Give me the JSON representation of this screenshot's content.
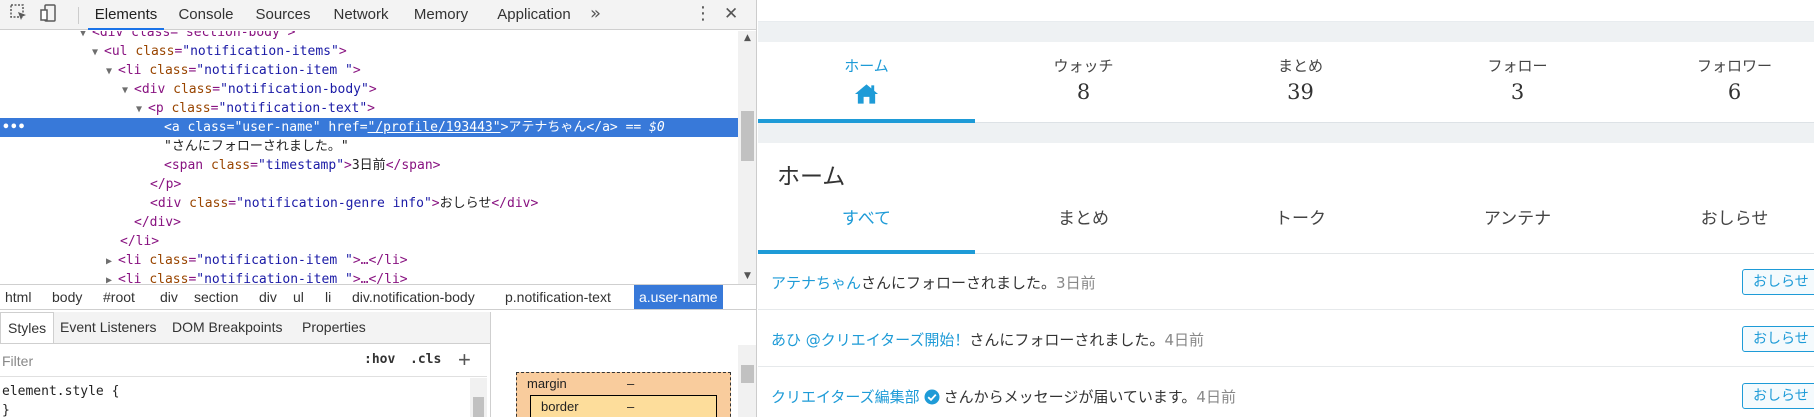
{
  "devtools": {
    "tabs": [
      "Elements",
      "Console",
      "Sources",
      "Network",
      "Memory",
      "Application"
    ],
    "active_tab": "Elements",
    "more_tabs_glyph": "»",
    "menu_glyph": "⋮",
    "close_glyph": "✕",
    "dom_lines": {
      "l0": {
        "tag_open": "<div class=\"section-body\">"
      },
      "l1": {
        "tag": "<ul",
        "attr": "class",
        "val": "\"notification-items\"",
        "end": ">"
      },
      "l2": {
        "tag": "<li",
        "attr": "class",
        "val": "\"notification-item \"",
        "end": ">"
      },
      "l3": {
        "tag": "<div",
        "attr": "class",
        "val": "\"notification-body\"",
        "end": ">"
      },
      "l4": {
        "tag": "<p",
        "attr": "class",
        "val": "\"notification-text\"",
        "end": ">"
      },
      "l5": {
        "tag": "<a",
        "attr1": "class",
        "val1": "\"user-name\"",
        "attr2": "href",
        "val2": "\"/profile/193443\"",
        "text": "アテナちゃん",
        "close": "</a>",
        "eq": "== $0"
      },
      "l6": {
        "text": "\"さんにフォローされました。\""
      },
      "l7": {
        "tag": "<span",
        "attr": "class",
        "val": "\"timestamp\"",
        "text": "3日前",
        "close": "</span>"
      },
      "l8": {
        "close": "</p>"
      },
      "l9": {
        "tag": "<div",
        "attr": "class",
        "val": "\"notification-genre info\"",
        "text": "おしらせ",
        "close": "</div>"
      },
      "l10": {
        "close": "</div>"
      },
      "l11": {
        "close": "</li>"
      },
      "l12": {
        "tag": "<li",
        "attr": "class",
        "val": "\"notification-item \"",
        "rest": ">…</li>"
      },
      "l13": {
        "tag": "<li",
        "attr": "class",
        "val": "\"notification-item \"",
        "rest": ">…</li>"
      }
    },
    "breadcrumbs": [
      "html",
      "body",
      "#root",
      "div",
      "section",
      "div",
      "ul",
      "li",
      "div.notification-body",
      "p.notification-text",
      "a.user-name"
    ],
    "styles_tabs": [
      "Styles",
      "Event Listeners",
      "DOM Breakpoints",
      "Properties"
    ],
    "filter_placeholder": "Filter",
    "hov_label": ":hov",
    "cls_label": ".cls",
    "plus_label": "+",
    "style_rule": "element.style {\n}",
    "box_model": {
      "margin_label": "margin",
      "margin_value": "–",
      "border_label": "border",
      "border_value": "–"
    }
  },
  "webpage": {
    "profile_nav": [
      {
        "label": "ホーム",
        "count": ""
      },
      {
        "label": "ウォッチ",
        "count": "8"
      },
      {
        "label": "まとめ",
        "count": "39"
      },
      {
        "label": "フォロー",
        "count": "3"
      },
      {
        "label": "フォロワー",
        "count": "6"
      }
    ],
    "section_title": "ホーム",
    "subtabs": [
      "すべて",
      "まとめ",
      "トーク",
      "アンテナ",
      "おしらせ"
    ],
    "notifications": [
      {
        "user": "アテナちゃん",
        "message": "さんにフォローされました。",
        "timestamp": "3日前",
        "genre": "おしらせ"
      },
      {
        "user": "あひ @クリエイターズ開始！",
        "message": "さんにフォローされました。",
        "timestamp": "4日前",
        "genre": "おしらせ"
      },
      {
        "user": "クリエイターズ編集部",
        "message": "さんからメッセージが届いています。",
        "timestamp": "4日前",
        "genre": "おしらせ"
      }
    ],
    "colors": {
      "accent": "#1e9bd7",
      "selection": "#3879d9"
    }
  }
}
